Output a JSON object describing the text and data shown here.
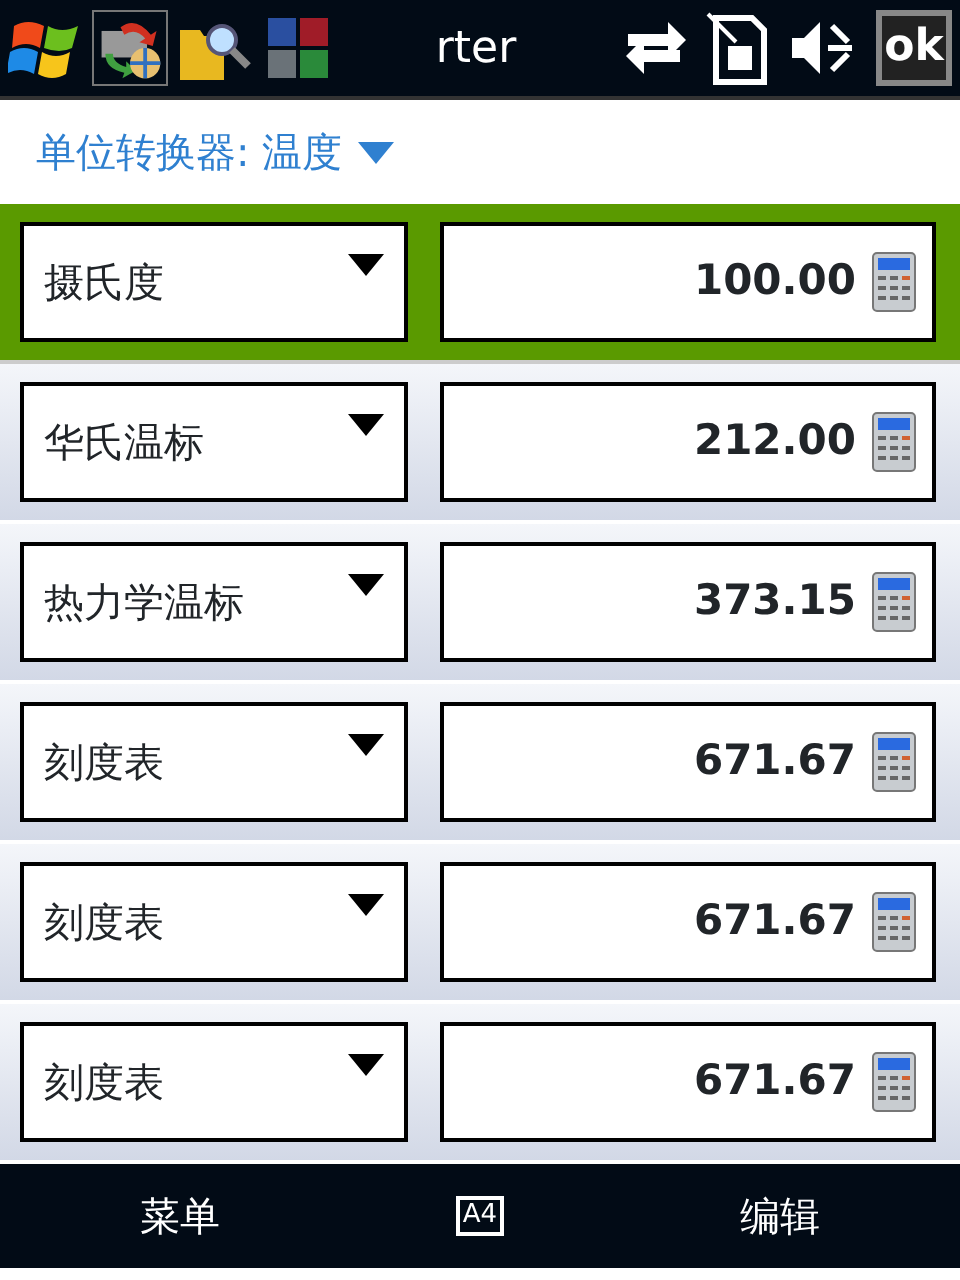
{
  "status_bar": {
    "title": "rter",
    "ok_button": "ok"
  },
  "header": {
    "title": "单位转换器: 温度"
  },
  "rows": [
    {
      "unit": "摄氏度",
      "value": "100.00",
      "selected": true
    },
    {
      "unit": "华氏温标",
      "value": "212.00",
      "selected": false
    },
    {
      "unit": "热力学温标",
      "value": "373.15",
      "selected": false
    },
    {
      "unit": "刻度表",
      "value": "671.67",
      "selected": false
    },
    {
      "unit": "刻度表",
      "value": "671.67",
      "selected": false
    },
    {
      "unit": "刻度表",
      "value": "671.67",
      "selected": false
    }
  ],
  "soft_keys": {
    "left": "菜单",
    "input_mode": "A4",
    "right": "编辑"
  }
}
